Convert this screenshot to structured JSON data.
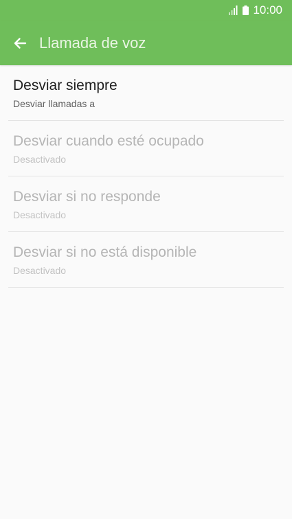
{
  "status_bar": {
    "time": "10:00",
    "icons": [
      "signal-icon",
      "battery-icon"
    ]
  },
  "app_bar": {
    "back_icon": "arrow-left-icon",
    "title": "Llamada de voz"
  },
  "colors": {
    "accent": "#6fbe5a",
    "background": "#fafafa",
    "text_primary": "#1f1f1f",
    "text_secondary": "#5f5f5f",
    "text_disabled": "#b5b5b5"
  },
  "items": [
    {
      "title": "Desviar siempre",
      "summary": "Desviar llamadas a",
      "enabled": true
    },
    {
      "title": "Desviar cuando esté ocupado",
      "summary": "Desactivado",
      "enabled": false
    },
    {
      "title": "Desviar si no responde",
      "summary": "Desactivado",
      "enabled": false
    },
    {
      "title": "Desviar si no está disponible",
      "summary": "Desactivado",
      "enabled": false
    }
  ]
}
